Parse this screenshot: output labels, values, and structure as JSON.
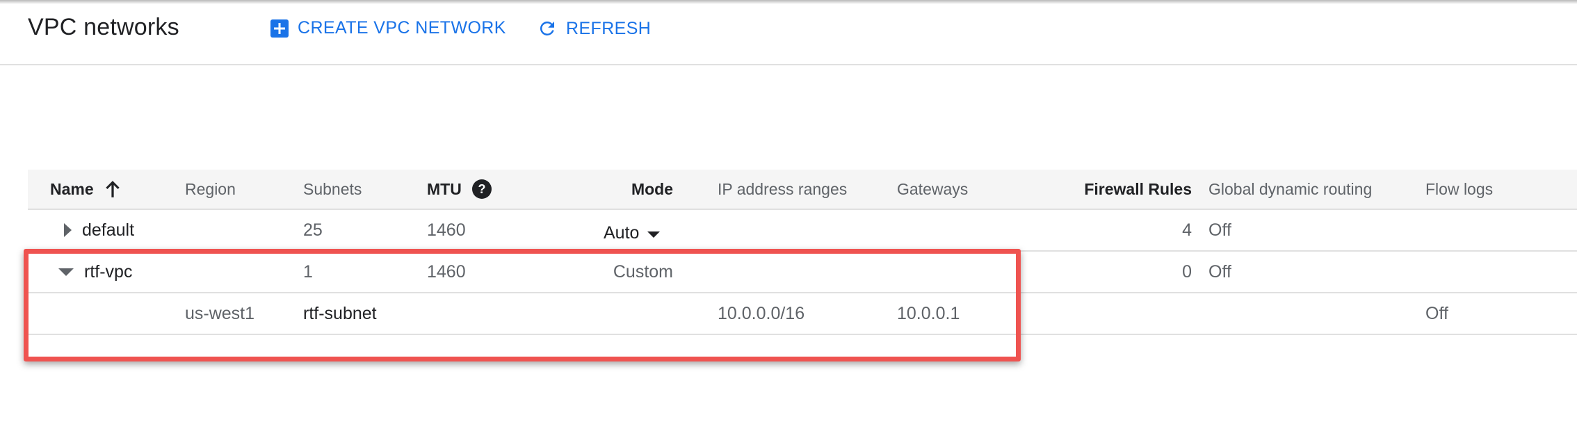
{
  "header": {
    "title": "VPC networks",
    "actions": {
      "create_label": "CREATE VPC NETWORK",
      "refresh_label": "REFRESH"
    }
  },
  "table": {
    "columns": {
      "name": "Name",
      "region": "Region",
      "subnets": "Subnets",
      "mtu": "MTU",
      "mode": "Mode",
      "ip_ranges": "IP address ranges",
      "gateways": "Gateways",
      "firewall_rules": "Firewall Rules",
      "global_routing": "Global dynamic routing",
      "flow_logs": "Flow logs"
    },
    "rows": [
      {
        "name": "default",
        "subnets": "25",
        "mtu": "1460",
        "mode": "Auto",
        "firewall_rules": "4",
        "global_routing": "Off"
      },
      {
        "name": "rtf-vpc",
        "subnets": "1",
        "mtu": "1460",
        "mode": "Custom",
        "firewall_rules": "0",
        "global_routing": "Off"
      },
      {
        "region": "us-west1",
        "subnet_name": "rtf-subnet",
        "ip_range": "10.0.0.0/16",
        "gateway": "10.0.0.1",
        "flow_logs": "Off"
      }
    ]
  },
  "colors": {
    "accent": "#1a73e8",
    "highlight": "#ef5350",
    "header_bg": "#f5f5f5"
  },
  "icons": {
    "create": "add-box-icon",
    "refresh": "refresh-icon",
    "sort": "arrow-upward-icon",
    "help": "help-circle-icon",
    "expand": "triangle-right-icon",
    "collapse": "triangle-down-icon",
    "dropdown": "caret-down-icon"
  }
}
